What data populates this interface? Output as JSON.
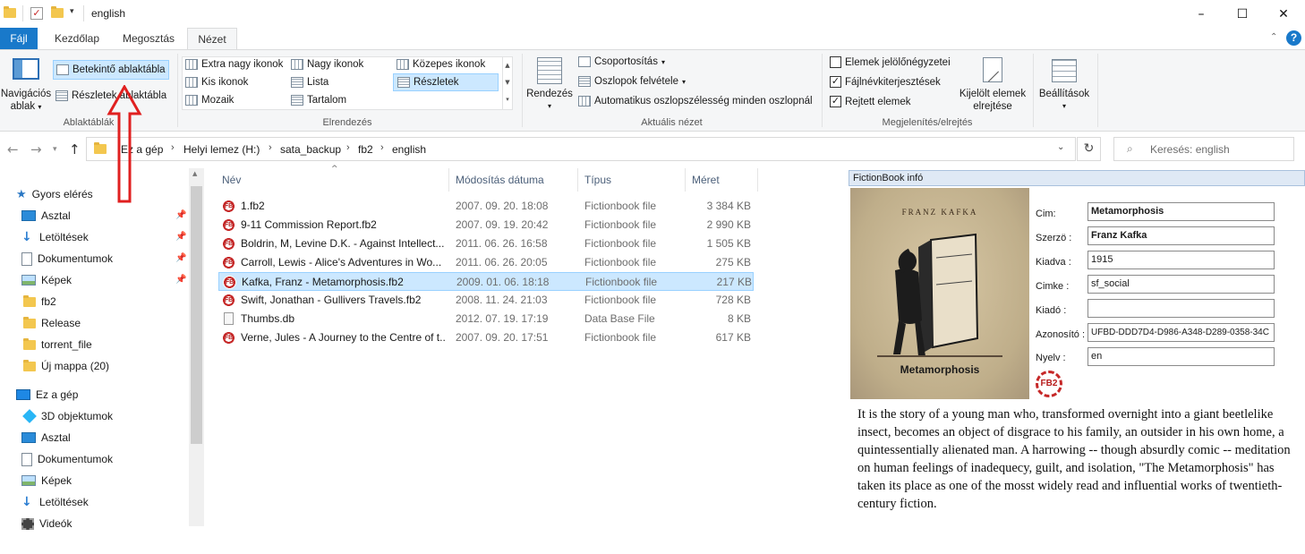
{
  "window": {
    "title": "english"
  },
  "ribbon_tabs": [
    "Fájl",
    "Kezdőlap",
    "Megosztás",
    "Nézet"
  ],
  "ribbon": {
    "panes": {
      "nav_pane_line1": "Navigációs",
      "nav_pane_line2": "ablak",
      "preview_pane": "Betekintő ablaktábla",
      "details_pane": "Részletek ablaktábla",
      "label": "Ablaktáblák"
    },
    "layout": {
      "items": [
        "Extra nagy ikonok",
        "Nagy ikonok",
        "Közepes ikonok",
        "Kis ikonok",
        "Lista",
        "Részletek",
        "Mozaik",
        "Tartalom"
      ],
      "label": "Elrendezés"
    },
    "current_view": {
      "sort": "Rendezés",
      "group_by": "Csoportosítás",
      "add_columns": "Oszlopok felvétele",
      "fit_columns": "Automatikus oszlopszélesség minden oszlopnál",
      "label": "Aktuális nézet"
    },
    "show_hide": {
      "item_checkboxes": "Elemek jelölőnégyzetei",
      "file_extensions": "Fájlnévkiterjesztések",
      "hidden_items": "Rejtett elemek",
      "hide_selected_line1": "Kijelölt elemek",
      "hide_selected_line2": "elrejtése",
      "label": "Megjelenítés/elrejtés"
    },
    "options": "Beállítások"
  },
  "address": {
    "crumbs": [
      "Ez a gép",
      "Helyi lemez (H:)",
      "sata_backup",
      "fb2",
      "english"
    ],
    "search_placeholder": "Keresés: english"
  },
  "nav_tree": {
    "quick_access": "Gyors elérés",
    "quick_items": [
      "Asztal",
      "Letöltések",
      "Dokumentumok",
      "Képek",
      "fb2",
      "Release",
      "torrent_file",
      "Új mappa (20)"
    ],
    "this_pc": "Ez a gép",
    "pc_items": [
      "3D objektumok",
      "Asztal",
      "Dokumentumok",
      "Képek",
      "Letöltések",
      "Videók"
    ]
  },
  "file_list": {
    "columns": [
      "Név",
      "Módosítás dátuma",
      "Típus",
      "Méret"
    ],
    "rows": [
      {
        "name": "1.fb2",
        "date": "2007. 09. 20. 18:08",
        "type": "Fictionbook file",
        "size": "3 384 KB"
      },
      {
        "name": "9-11 Commission Report.fb2",
        "date": "2007. 09. 19. 20:42",
        "type": "Fictionbook file",
        "size": "2 990 KB"
      },
      {
        "name": "Boldrin, M, Levine D.K. - Against Intellect...",
        "date": "2011. 06. 26. 16:58",
        "type": "Fictionbook file",
        "size": "1 505 KB"
      },
      {
        "name": "Carroll, Lewis - Alice's Adventures in Wo...",
        "date": "2011. 06. 26. 20:05",
        "type": "Fictionbook file",
        "size": "275 KB"
      },
      {
        "name": "Kafka, Franz - Metamorphosis.fb2",
        "date": "2009. 01. 06. 18:18",
        "type": "Fictionbook file",
        "size": "217 KB"
      },
      {
        "name": "Swift, Jonathan - Gullivers Travels.fb2",
        "date": "2008. 11. 24. 21:03",
        "type": "Fictionbook file",
        "size": "728 KB"
      },
      {
        "name": "Thumbs.db",
        "date": "2012. 07. 19. 17:19",
        "type": "Data Base File",
        "size": "8 KB"
      },
      {
        "name": "Verne, Jules - A Journey to the Centre of t...",
        "date": "2007. 09. 20. 17:51",
        "type": "Fictionbook file",
        "size": "617 KB"
      }
    ]
  },
  "preview": {
    "header": "FictionBook infó",
    "cover_author": "FRANZ KAFKA",
    "cover_title": "Metamorphosis",
    "fields": [
      {
        "label": "Cim:",
        "value": "Metamorphosis"
      },
      {
        "label": "Szerzö :",
        "value": "Franz Kafka"
      },
      {
        "label": "Kiadva :",
        "value": "1915"
      },
      {
        "label": "Cimke :",
        "value": "sf_social"
      },
      {
        "label": "Kiadó :",
        "value": ""
      },
      {
        "label": "Azonosító :",
        "value": "UFBD-DDD7D4-D986-A348-D289-0358-34C"
      },
      {
        "label": "Nyelv :",
        "value": "en"
      }
    ],
    "logo_text": "FB2",
    "description": "It is the story of a young man who, transformed overnight into a giant beetlelike insect, becomes an object of disgrace to his family, an outsider in his own home, a quintessentially alienated man. A harrowing -- though absurdly comic -- meditation on human feelings of inadequecy, guilt, and isolation, \"The Metamorphosis\" has taken its place as one of the mosst widely read and influential works of twentieth-century fiction."
  },
  "colors": {
    "accent": "#1979ca",
    "selection": "#cce8ff",
    "annotation": "#e02020"
  }
}
